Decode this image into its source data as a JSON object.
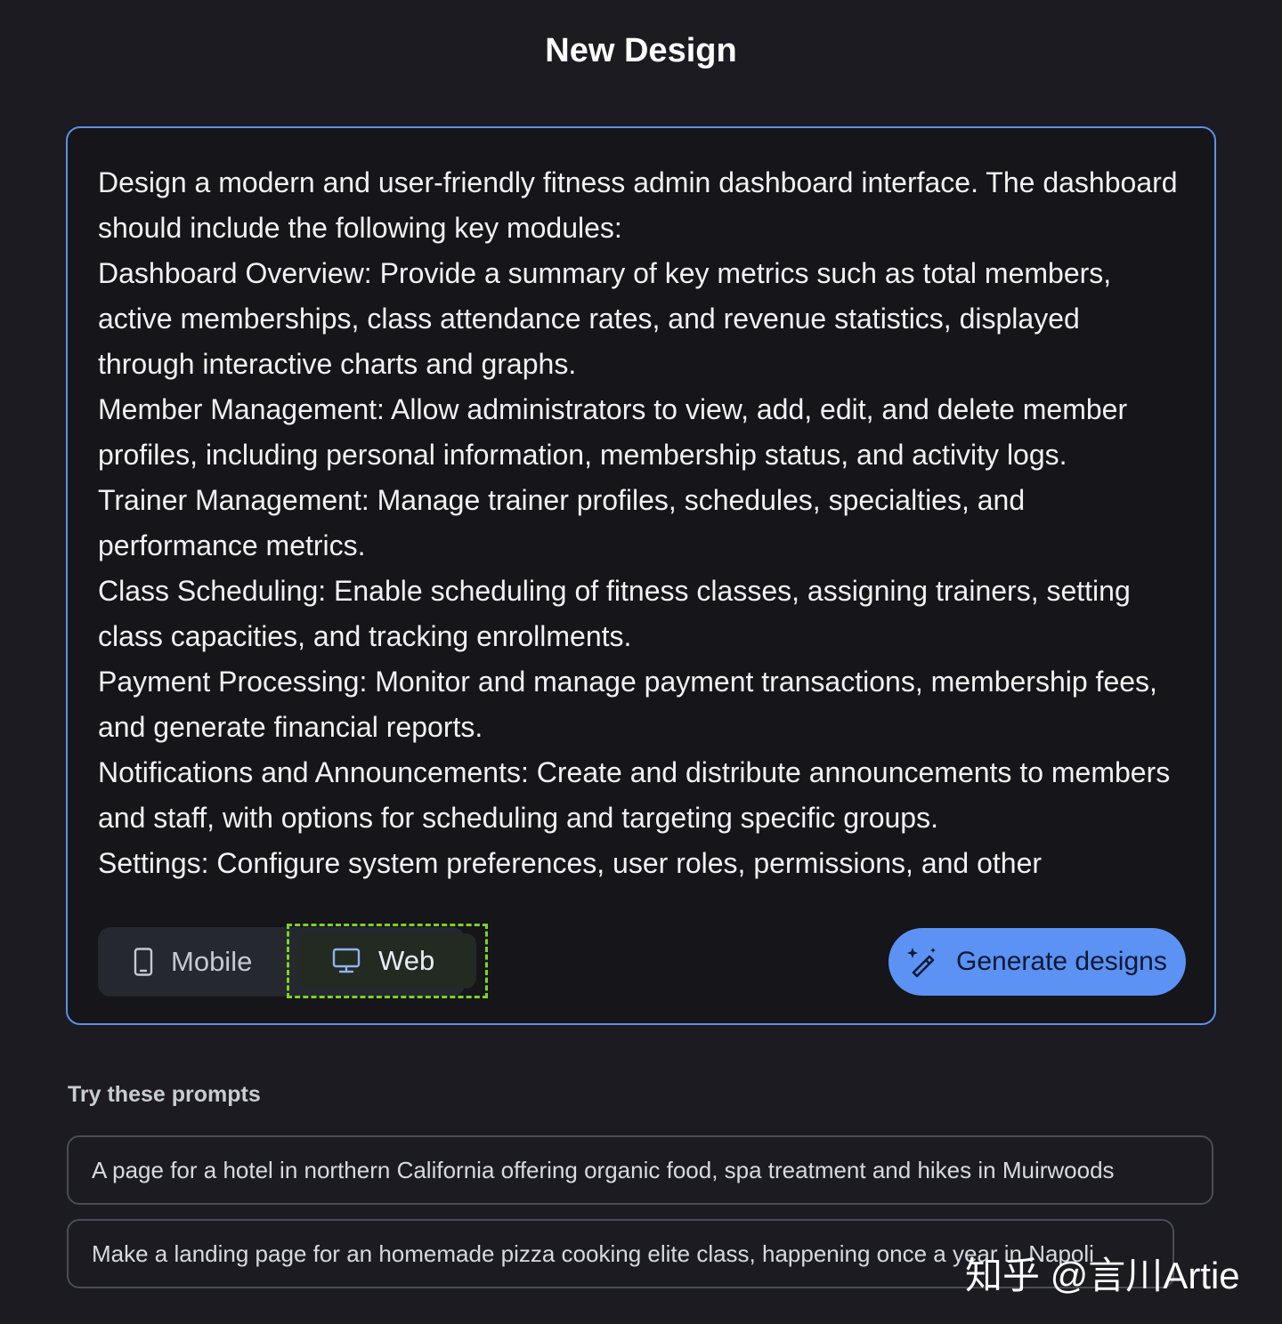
{
  "header": {
    "title": "New Design"
  },
  "prompt": {
    "text": "Design a modern and user-friendly fitness admin dashboard interface. The dashboard should include the following key modules:\nDashboard Overview: Provide a summary of key metrics such as total members, active memberships, class attendance rates, and revenue statistics, displayed through interactive charts and graphs.\nMember Management: Allow administrators to view, add, edit, and delete member profiles, including personal information, membership status, and activity logs.\nTrainer Management: Manage trainer profiles, schedules, specialties, and performance metrics.\nClass Scheduling: Enable scheduling of fitness classes, assigning trainers, setting class capacities, and tracking enrollments.\nPayment Processing: Monitor and manage payment transactions, membership fees, and generate financial reports.\nNotifications and Announcements: Create and distribute announcements to members and staff, with options for scheduling and targeting specific groups.\nSettings: Configure system preferences, user roles, permissions, and other"
  },
  "mode_toggle": {
    "options": [
      {
        "label": "Mobile",
        "icon": "phone-icon",
        "selected": false
      },
      {
        "label": "Web",
        "icon": "monitor-icon",
        "selected": true
      }
    ]
  },
  "generate": {
    "label": "Generate designs",
    "icon": "magic-wand-icon"
  },
  "suggestions": {
    "heading": "Try these prompts",
    "items": [
      "A page for a hotel in northern California offering organic food, spa treatment and hikes in Muirwoods",
      "Make a landing page for an homemade pizza cooking elite class, happening once a year in Napoli"
    ]
  },
  "watermark": {
    "text": "知乎 @言川Artie"
  },
  "colors": {
    "background": "#1b1b21",
    "card_border": "#5f8fe3",
    "primary_button": "#5b92f3",
    "selection_outline": "#7ed321"
  }
}
